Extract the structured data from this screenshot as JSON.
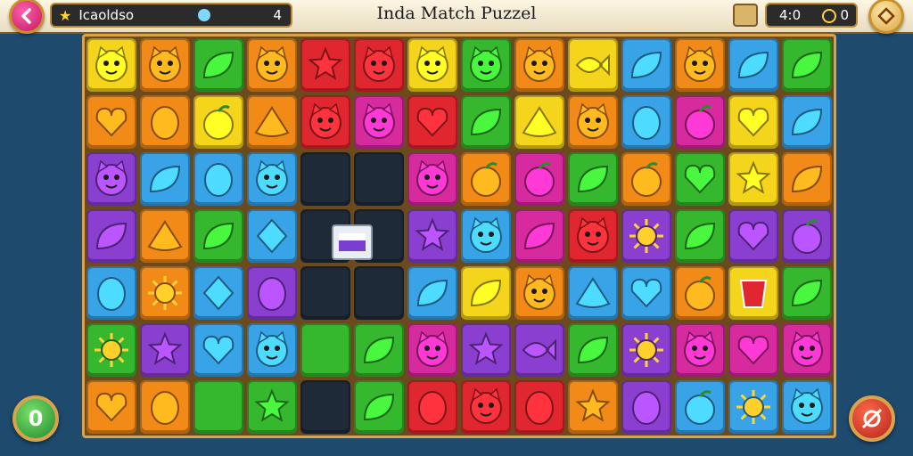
{
  "header": {
    "player_name": "Icaoldso",
    "player_value": "4",
    "title": "Inda Match Puzzel",
    "score": "4:0",
    "extra_value": "0",
    "counter": "0"
  },
  "colors": {
    "red": "#e0262e",
    "orange": "#f28a18",
    "yellow": "#f5d51c",
    "green": "#36b82e",
    "blue": "#39a3e8",
    "purple": "#8a3fd0",
    "magenta": "#d62a9e",
    "gray": "#9aa3ad",
    "dark": "#1e2a38"
  },
  "board": {
    "rows": 7,
    "cols": 14,
    "tiles": [
      [
        "yellow:face",
        "orange:face",
        "green:leaf",
        "orange:face",
        "red:star",
        "red:face",
        "yellow:face",
        "green:face",
        "orange:face",
        "yellow:fish",
        "blue:leaf",
        "orange:face",
        "blue:leaf",
        "green:leaf"
      ],
      [
        "orange:heart",
        "orange:blob",
        "yellow:fruit",
        "orange:shell",
        "red:face",
        "magenta:face",
        "red:heart",
        "green:leaf",
        "yellow:shell",
        "orange:face",
        "blue:blob",
        "magenta:fruit",
        "yellow:heart",
        "blue:leaf"
      ],
      [
        "purple:face",
        "blue:leaf",
        "blue:drop",
        "blue:face",
        "dark:empty",
        "dark:empty",
        "magenta:face",
        "orange:fruit",
        "magenta:fruit",
        "green:leaf",
        "orange:fruit",
        "green:heart",
        "yellow:star",
        "orange:leaf"
      ],
      [
        "purple:leaf",
        "orange:shell",
        "green:leaf",
        "blue:gem",
        "dark:empty",
        "dark:empty",
        "purple:star",
        "blue:face",
        "magenta:leaf",
        "red:face",
        "purple:sun",
        "green:leaf",
        "purple:heart",
        "purple:fruit"
      ],
      [
        "blue:blob",
        "orange:sun",
        "blue:gem",
        "purple:blob",
        "dark:empty",
        "dark:empty",
        "blue:leaf",
        "yellow:leaf",
        "orange:face",
        "blue:shell",
        "blue:heart",
        "orange:fruit",
        "yellow:cup",
        "green:leaf"
      ],
      [
        "green:sun",
        "purple:star",
        "blue:heart",
        "blue:face",
        "green:empty",
        "green:leaf",
        "magenta:face",
        "purple:star",
        "purple:fish",
        "green:leaf",
        "purple:sun",
        "magenta:face",
        "magenta:heart",
        "magenta:face"
      ],
      [
        "orange:heart",
        "orange:blob",
        "green:empty",
        "green:star",
        "dark:empty",
        "green:leaf",
        "red:blob",
        "red:face",
        "red:blob",
        "orange:star",
        "purple:blob",
        "blue:fruit",
        "blue:sun",
        "blue:face"
      ]
    ]
  }
}
